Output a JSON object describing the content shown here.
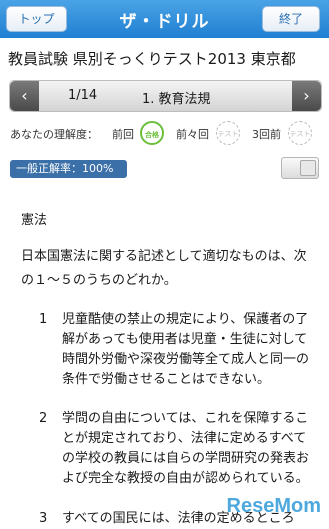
{
  "header": {
    "top_button": "トップ",
    "logo": "ザ・ドリル",
    "end_button": "終了"
  },
  "title": "教員試験 県別そっくりテスト2013 東京都",
  "nav": {
    "prev_icon": "chevron-left",
    "next_icon": "chevron-right",
    "page": "1/14",
    "section": "1. 教育法規"
  },
  "understanding": {
    "label": "あなたの理解度：",
    "slots": [
      {
        "label": "前回",
        "stamp": "テスト\n合格"
      },
      {
        "label": "前々回",
        "stamp": "テスト"
      },
      {
        "label": "3回前",
        "stamp": "テスト"
      }
    ]
  },
  "badge": "一般正解率：100%",
  "subject": "憲法",
  "question": "日本国憲法に関する記述として適切なものは、次の１～５のうちのどれか。",
  "choices": [
    {
      "num": "1",
      "text": "児童酷使の禁止の規定により、保護者の了解があっても使用者は児童・生徒に対して時間外労働や深夜労働等全て成人と同一の条件で労働させることはできない。"
    },
    {
      "num": "2",
      "text": "学問の自由については、これを保障することが規定されており、法律に定めるすべての学校の教員には自らの学問研究の発表および完全な教授の自由が認められている。"
    },
    {
      "num": "3",
      "text": "すべての国民には、法律の定めるところ"
    }
  ],
  "watermark": "ReseMom",
  "colors": {
    "header": "#1f7fd1",
    "badge": "#3a6fa8",
    "stamp_done": "#6bbf3c"
  }
}
